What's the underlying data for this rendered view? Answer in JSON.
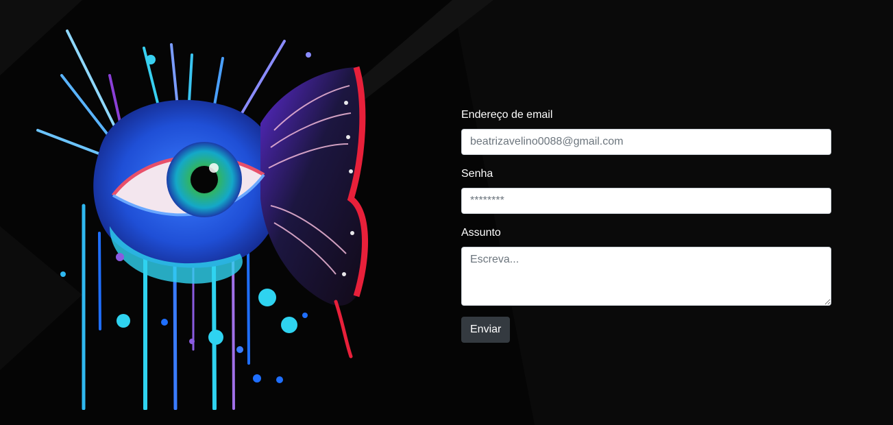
{
  "colors": {
    "background": "#050505",
    "button": "#343a40",
    "iris": "#2fb36a",
    "splash_blue": "#1f6fff",
    "splash_cyan": "#2fd3f0",
    "wing_red": "#e8203a",
    "wing_purple": "#6a2fc9"
  },
  "illustration": {
    "icon": "eye-butterfly-artwork"
  },
  "form": {
    "email_label": "Endereço de email",
    "email_placeholder": "beatrizavelino0088@gmail.com",
    "password_label": "Senha",
    "password_placeholder": "********",
    "subject_label": "Assunto",
    "subject_placeholder": "Escreva...",
    "submit_label": "Enviar"
  }
}
